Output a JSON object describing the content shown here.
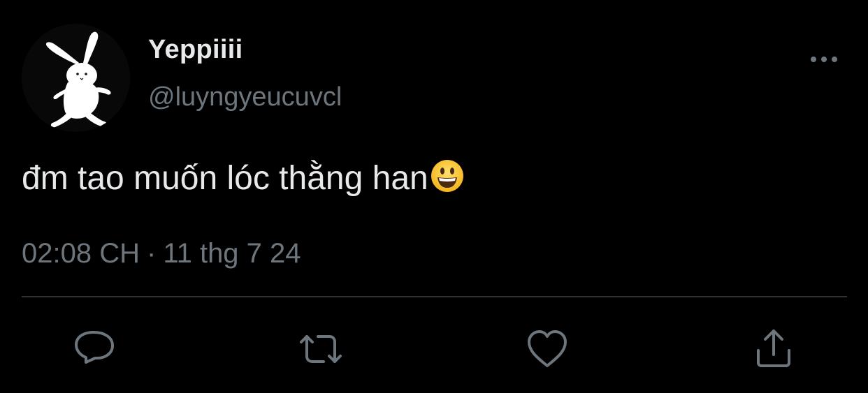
{
  "user": {
    "display_name": "Yeppiiii",
    "handle": "@luyngyeucuvcl",
    "avatar_icon": "white-bunny-plush-icon"
  },
  "tweet": {
    "text": "đm tao muốn lóc thằng han",
    "emoji": "grinning-face-with-big-eyes-icon"
  },
  "meta": {
    "time": "02:08 CH",
    "separator": "·",
    "date": "11 thg 7 24"
  },
  "actions": {
    "more_icon": "more-horizontal-icon",
    "reply_icon": "reply-icon",
    "retweet_icon": "retweet-icon",
    "like_icon": "heart-icon",
    "share_icon": "share-icon"
  },
  "colors": {
    "background": "#000000",
    "primary_text": "#e7e9ea",
    "secondary_text": "#6e767d",
    "divider": "#2f3336"
  }
}
